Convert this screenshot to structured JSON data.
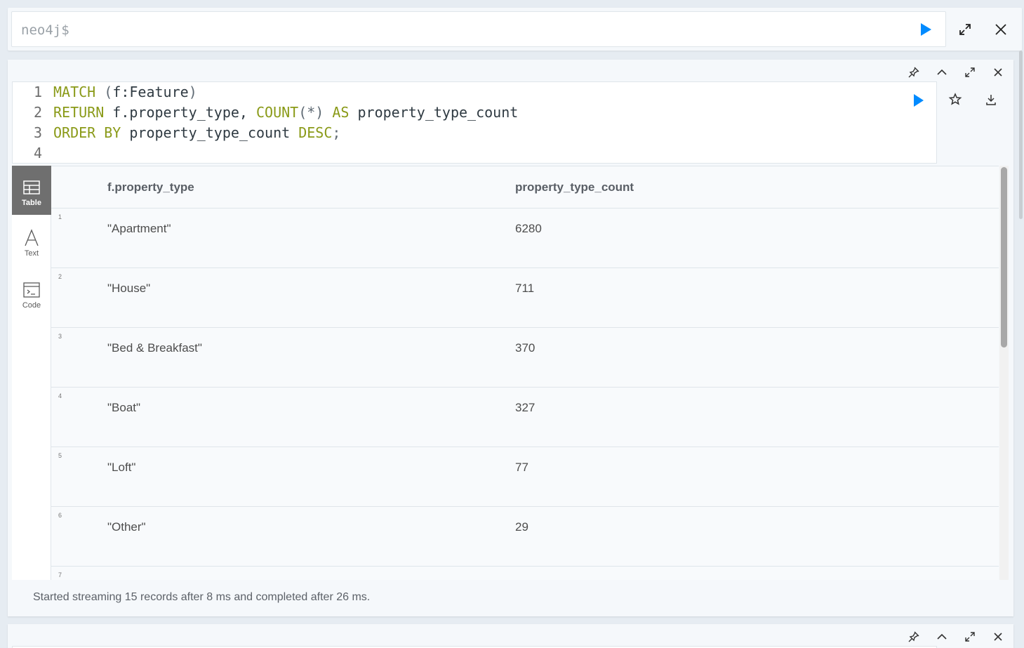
{
  "top_prompt": {
    "placeholder": "neo4j$"
  },
  "editor": {
    "lines": [
      {
        "num": "1",
        "tokens": [
          {
            "t": "MATCH",
            "c": "kw"
          },
          {
            "t": " (",
            "c": "punct"
          },
          {
            "t": "f:Feature",
            "c": "ident"
          },
          {
            "t": ")",
            "c": "punct"
          }
        ]
      },
      {
        "num": "2",
        "tokens": [
          {
            "t": "RETURN",
            "c": "kw"
          },
          {
            "t": " f.property_type, ",
            "c": "ident"
          },
          {
            "t": "COUNT",
            "c": "kw"
          },
          {
            "t": "(*)",
            "c": "punct"
          },
          {
            "t": " AS",
            "c": "kw"
          },
          {
            "t": " property_type_count",
            "c": "ident"
          }
        ]
      },
      {
        "num": "3",
        "tokens": [
          {
            "t": "ORDER BY",
            "c": "kw"
          },
          {
            "t": " property_type_count ",
            "c": "ident"
          },
          {
            "t": "DESC",
            "c": "kw"
          },
          {
            "t": ";",
            "c": "punct"
          }
        ]
      },
      {
        "num": "4",
        "tokens": []
      }
    ]
  },
  "result_nav": {
    "items": [
      {
        "label": "Table",
        "icon": "table-icon",
        "active": true
      },
      {
        "label": "Text",
        "icon": "text-icon",
        "active": false
      },
      {
        "label": "Code",
        "icon": "code-icon",
        "active": false
      }
    ]
  },
  "table": {
    "columns": [
      "f.property_type",
      "property_type_count"
    ],
    "rows": [
      {
        "n": "1",
        "type": "\"Apartment\"",
        "count": "6280"
      },
      {
        "n": "2",
        "type": "\"House\"",
        "count": "711"
      },
      {
        "n": "3",
        "type": "\"Bed & Breakfast\"",
        "count": "370"
      },
      {
        "n": "4",
        "type": "\"Boat\"",
        "count": "327"
      },
      {
        "n": "5",
        "type": "\"Loft\"",
        "count": "77"
      },
      {
        "n": "6",
        "type": "\"Other\"",
        "count": "29"
      },
      {
        "n": "7",
        "type": "",
        "count": ""
      }
    ]
  },
  "status": "Started streaming 15 records after 8 ms and completed after 26 ms.",
  "colors": {
    "accent": "#018bff",
    "keyword": "#8a9a18",
    "active_nav": "#6f6f6f"
  }
}
